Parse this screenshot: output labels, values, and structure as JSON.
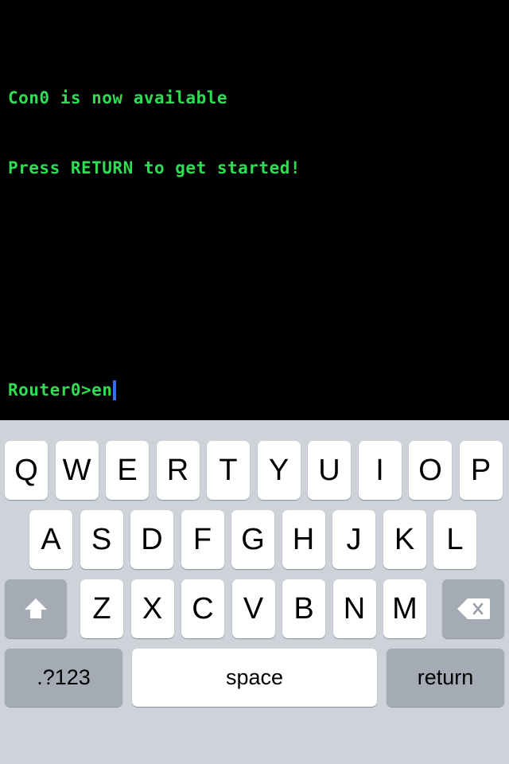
{
  "terminal": {
    "background_color": "#000000",
    "text_color": "#2fdc54",
    "caret_color": "#3a6ef0",
    "lines": [
      "Con0 is now available",
      "Press RETURN to get started!"
    ],
    "prompt": "Router0>en"
  },
  "keyboard": {
    "background_color": "#ced2d9",
    "key_color": "#ffffff",
    "special_key_color": "#a4abb5",
    "row1": [
      "Q",
      "W",
      "E",
      "R",
      "T",
      "Y",
      "U",
      "I",
      "O",
      "P"
    ],
    "row2": [
      "A",
      "S",
      "D",
      "F",
      "G",
      "H",
      "J",
      "K",
      "L"
    ],
    "row3": [
      "Z",
      "X",
      "C",
      "V",
      "B",
      "N",
      "M"
    ],
    "shift_icon": "shift-arrow-icon",
    "backspace_icon": "backspace-delete-icon",
    "numbers_label": ".?123",
    "space_label": "space",
    "return_label": "return"
  }
}
